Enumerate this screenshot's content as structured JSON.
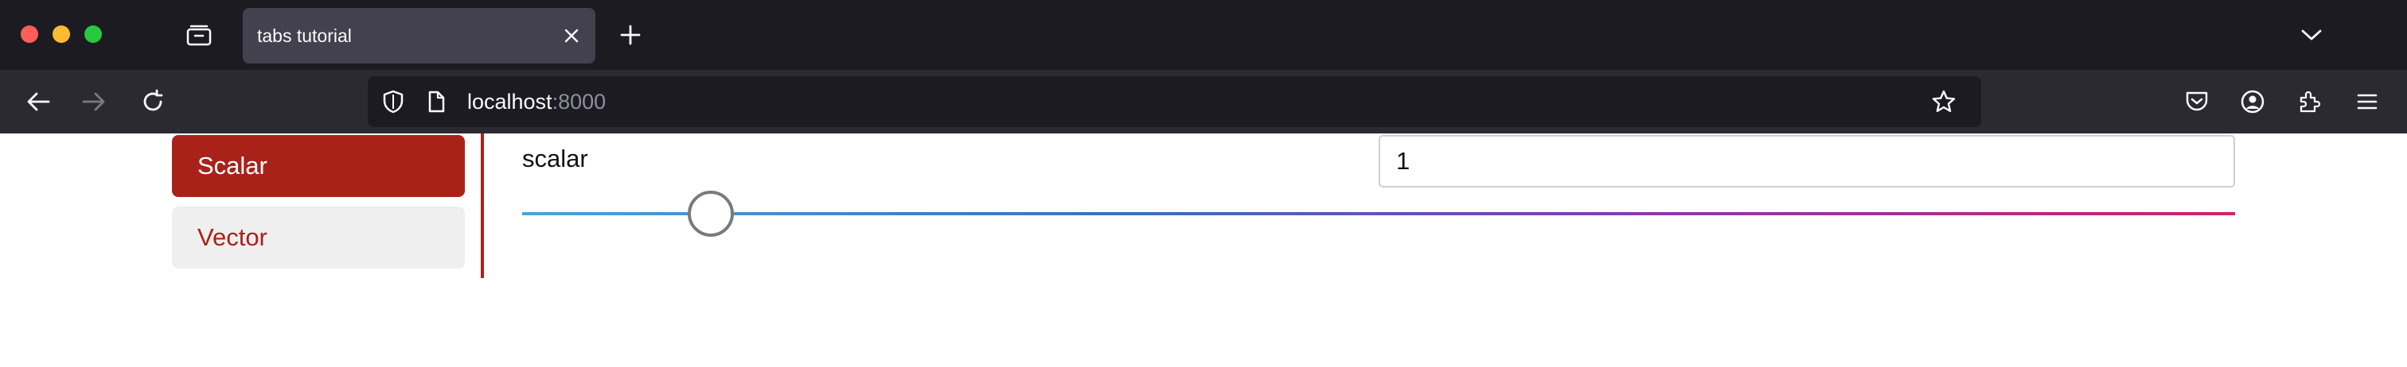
{
  "browser": {
    "tab": {
      "title": "tabs tutorial"
    },
    "url": {
      "host": "localhost",
      "port": ":8000"
    }
  },
  "page": {
    "tabs": [
      {
        "label": "Scalar",
        "active": true
      },
      {
        "label": "Vector",
        "active": false
      }
    ],
    "scalar_label": "scalar",
    "scalar_value": "1",
    "slider_fraction": 0.11,
    "colors": {
      "accent": "#a82219",
      "inactive_tab_bg": "#efefef"
    }
  }
}
